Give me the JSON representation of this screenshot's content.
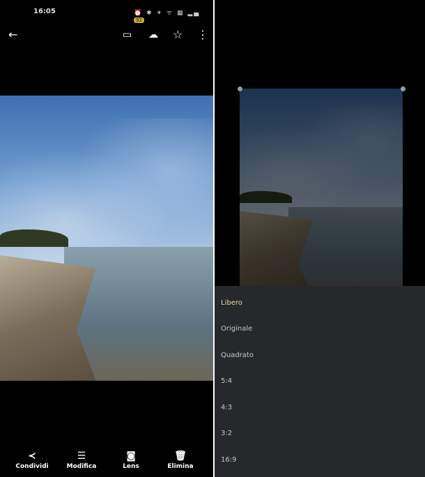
{
  "status": {
    "time": "16:05",
    "battery": "92"
  },
  "toolbar": {
    "back": "←",
    "cast": "▭",
    "backup": "☁",
    "favorite": "☆",
    "more": "⋮"
  },
  "bottom": [
    {
      "icon": "share-icon",
      "glyph": "≺",
      "label": "Condividi"
    },
    {
      "icon": "edit-sliders-icon",
      "glyph": "☰",
      "label": "Modifica"
    },
    {
      "icon": "lens-icon",
      "glyph": "◙",
      "label": "Lens"
    },
    {
      "icon": "trash-icon",
      "glyph": "🗑",
      "label": "Elimina"
    }
  ],
  "crop_menu": {
    "items": [
      "Libero",
      "Originale",
      "Quadrato",
      "5:4",
      "4:3",
      "3:2",
      "16:9"
    ],
    "selected": "Libero"
  },
  "colors": {
    "selected": "#e6dd9a",
    "menu_bg": "#26282c"
  }
}
